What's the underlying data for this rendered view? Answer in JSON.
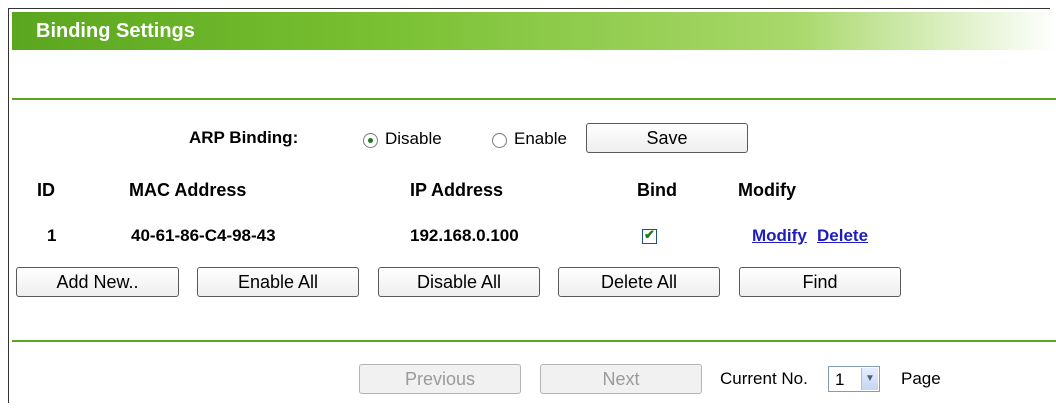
{
  "header": {
    "title": "Binding Settings"
  },
  "arp": {
    "label": "ARP Binding:",
    "options": [
      "Disable",
      "Enable"
    ],
    "selected": "Disable",
    "save_label": "Save"
  },
  "table": {
    "headers": [
      "ID",
      "MAC Address",
      "IP Address",
      "Bind",
      "Modify"
    ],
    "rows": [
      {
        "id": "1",
        "mac": "40-61-86-C4-98-43",
        "ip": "192.168.0.100",
        "bind": true,
        "modify": "Modify",
        "delete": "Delete"
      }
    ]
  },
  "actions": {
    "add_new": "Add New..",
    "enable_all": "Enable All",
    "disable_all": "Disable All",
    "delete_all": "Delete All",
    "find": "Find"
  },
  "pagination": {
    "previous": "Previous",
    "next": "Next",
    "current_label": "Current No.",
    "current_value": "1",
    "page_label": "Page"
  },
  "colors": {
    "header_green": "#5aa61e",
    "link_blue": "#1d1dbd"
  }
}
